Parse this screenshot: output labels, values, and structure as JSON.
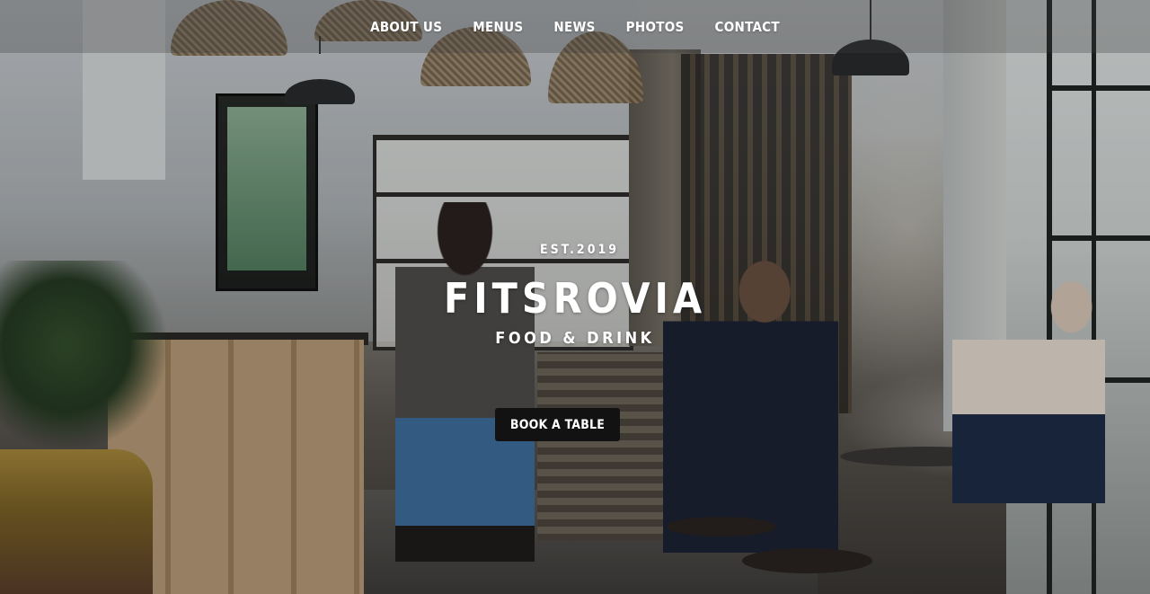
{
  "nav": {
    "items": [
      {
        "label": "ABOUT US"
      },
      {
        "label": "MENUS"
      },
      {
        "label": "NEWS"
      },
      {
        "label": "PHOTOS"
      },
      {
        "label": "CONTACT"
      }
    ]
  },
  "hero": {
    "established": "EST.2019",
    "title": "FITSROVIA",
    "subtitle": "FOOD & DRINK",
    "cta_label": "BOOK A TABLE"
  },
  "colors": {
    "button_background": "#121212",
    "text": "#ffffff"
  }
}
